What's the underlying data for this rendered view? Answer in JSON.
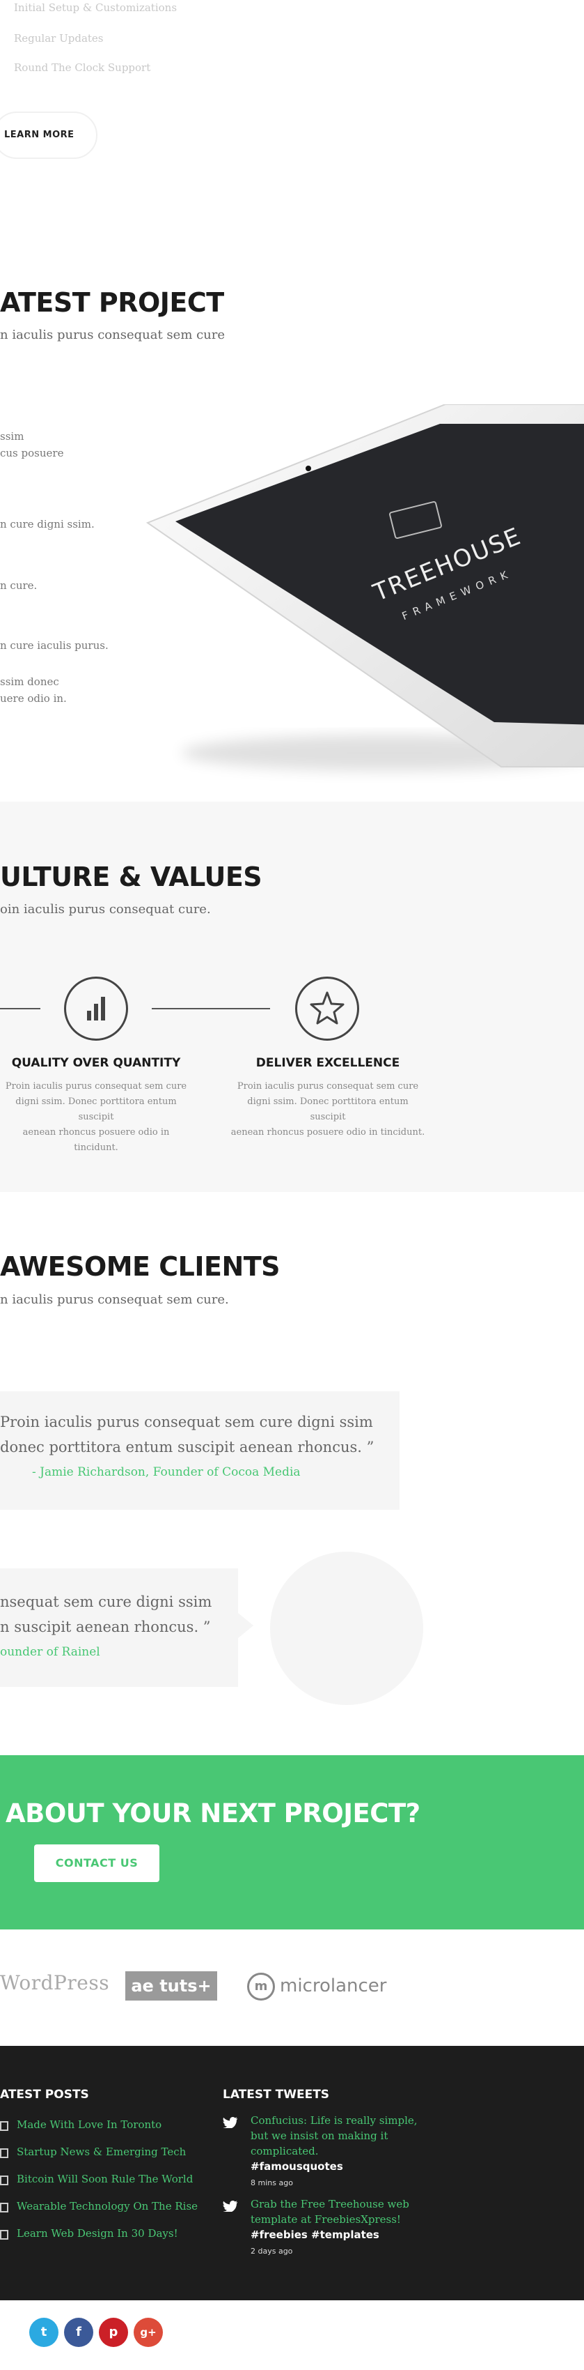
{
  "features": {
    "items": [
      "Initial Setup & Customizations",
      "Regular Updates",
      "Round The Clock Support"
    ],
    "learn_more": "LEARN MORE"
  },
  "project": {
    "title": "ATEST PROJECT",
    "subtitle": "n iaculis purus consequat sem cure",
    "lines": [
      "ssim",
      "cus posuere",
      "n cure  digni ssim.",
      "n cure.",
      "n cure iaculis purus.",
      "ssim donec",
      "uere odio in."
    ],
    "tablet": {
      "brand": "TREEHOUSE",
      "tagline": "FRAMEWORK"
    }
  },
  "culture": {
    "title": "ULTURE & VALUES",
    "subtitle": "oin iaculis purus consequat cure.",
    "values": [
      {
        "title": "QUALITY OVER QUANTITY",
        "desc": [
          "Proin iaculis purus consequat sem cure",
          "digni ssim. Donec porttitora entum suscipit",
          "aenean rhoncus posuere odio in tincidunt."
        ],
        "icon": "bar-chart-icon"
      },
      {
        "title": "DELIVER EXCELLENCE",
        "desc": [
          "Proin iaculis purus consequat sem cure",
          "digni ssim. Donec porttitora entum suscipit",
          "aenean rhoncus posuere odio in tincidunt."
        ],
        "icon": "star-icon"
      }
    ]
  },
  "clients": {
    "title": "AWESOME CLIENTS",
    "subtitle": "n iaculis purus consequat sem cure.",
    "testimonials": [
      {
        "lines": [
          "Proin iaculis purus consequat sem cure  digni ssim",
          "donec porttitora entum suscipit aenean rhoncus. ”"
        ],
        "author": "- Jamie Richardson, Founder of Cocoa Media"
      },
      {
        "lines": [
          "nsequat sem cure  digni ssim",
          "n suscipit aenean rhoncus. ”"
        ],
        "author": "ounder of Rainel"
      }
    ]
  },
  "cta": {
    "title": "ABOUT YOUR NEXT PROJECT?",
    "button": "CONTACT US"
  },
  "logos": {
    "wordpress": "WordPress",
    "aetuts": "ae tuts+",
    "microlancer_mark": "m",
    "microlancer": "microlancer"
  },
  "footer": {
    "posts_heading": "ATEST POSTS",
    "posts": [
      "Made With Love In Toronto",
      "Startup News & Emerging Tech",
      "Bitcoin Will Soon Rule The World",
      "Wearable Technology On The Rise",
      "Learn Web Design In 30 Days!"
    ],
    "tweets_heading": "LATEST TWEETS",
    "tweets": [
      {
        "lines": [
          "Confucius: Life is really simple,",
          "but we insist on making it",
          "complicated."
        ],
        "tags": "#famousquotes",
        "time": "8 mins ago"
      },
      {
        "lines": [
          "Grab the Free Treehouse web",
          "template at FreebiesXpress!"
        ],
        "tags": "#freebies #templates",
        "time": "2 days ago"
      }
    ]
  },
  "social": [
    {
      "name": "twitter",
      "glyph": "t",
      "color": "#2ba9e1"
    },
    {
      "name": "facebook",
      "glyph": "f",
      "color": "#3b5998"
    },
    {
      "name": "pinterest",
      "glyph": "p",
      "color": "#cb2027"
    },
    {
      "name": "googleplus",
      "glyph": "g+",
      "color": "#dd4b39"
    }
  ],
  "colors": {
    "accent": "#49c774",
    "dark": "#1d1d1d",
    "light_bg": "#f7f7f7"
  }
}
